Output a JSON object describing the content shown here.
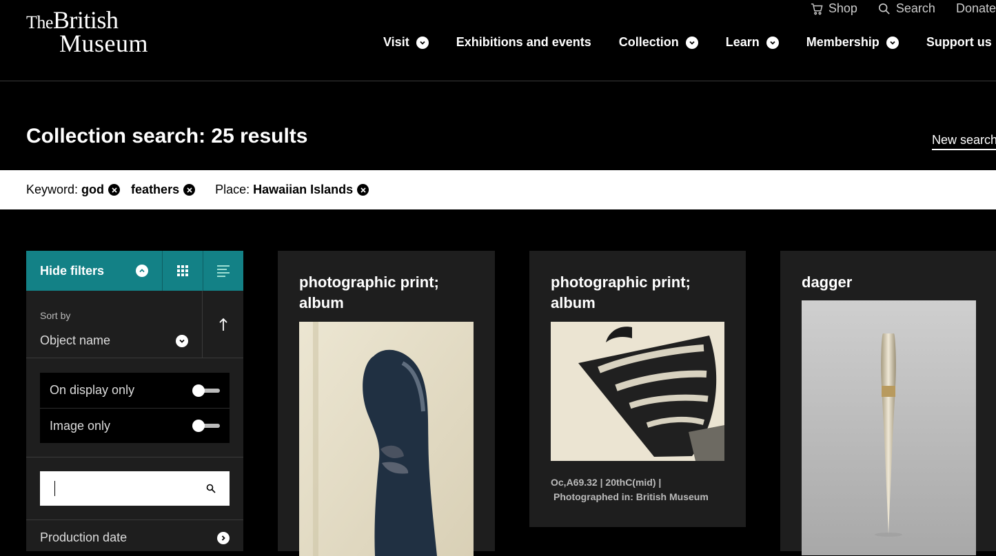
{
  "header": {
    "logo_the": "The",
    "logo_british": "British",
    "logo_museum": "Museum",
    "utility": {
      "shop": "Shop",
      "search": "Search",
      "donate": "Donate"
    },
    "nav": [
      "Visit",
      "Exhibitions and events",
      "Collection",
      "Learn",
      "Membership",
      "Support us"
    ]
  },
  "page": {
    "title": "Collection search: 25 results",
    "new_search": "New search"
  },
  "active_filters": {
    "keyword_label": "Keyword:",
    "keywords": [
      "god",
      "feathers"
    ],
    "place_label": "Place:",
    "place": "Hawaiian Islands"
  },
  "sidebar": {
    "hide_filters": "Hide filters",
    "sort_label": "Sort by",
    "sort_value": "Object name",
    "toggles": [
      {
        "label": "On display only",
        "on": false
      },
      {
        "label": "Image only",
        "on": false
      }
    ],
    "search_value": "",
    "facet": "Production date"
  },
  "results": [
    {
      "title_line1": "photographic print;",
      "title_line2": "album"
    },
    {
      "title_line1": "photographic print;",
      "title_line2": "album",
      "meta_line1": "Oc,A69.32  | 20thC(mid)  |",
      "meta_line2": "Photographed in: British Museum"
    },
    {
      "title_line1": "dagger"
    }
  ],
  "colors": {
    "accent": "#138186",
    "background": "#000000",
    "card": "#1e1e1e"
  },
  "icons": [
    "cart-icon",
    "search-icon",
    "chevron-down-icon",
    "chevron-up-icon",
    "grid-view-icon",
    "list-view-icon",
    "sort-direction-icon",
    "close-icon",
    "chevron-right-icon"
  ]
}
